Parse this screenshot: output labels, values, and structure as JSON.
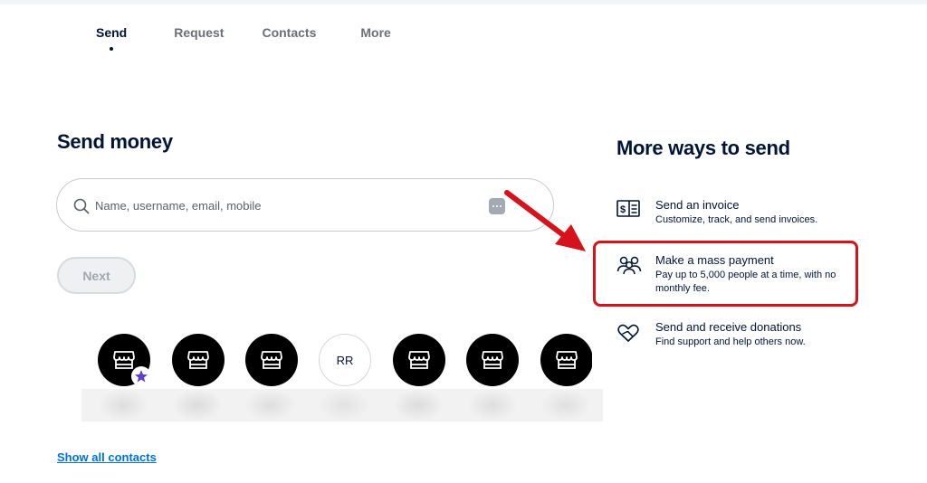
{
  "nav": {
    "tabs": [
      {
        "label": "Send",
        "active": true
      },
      {
        "label": "Request",
        "active": false
      },
      {
        "label": "Contacts",
        "active": false
      },
      {
        "label": "More",
        "active": false
      }
    ]
  },
  "send_money": {
    "title": "Send money",
    "search": {
      "placeholder": "Name, username, email, mobile",
      "value": ""
    },
    "next_label": "Next",
    "contacts": [
      {
        "type": "store-icon",
        "favorite": true
      },
      {
        "type": "store-icon",
        "favorite": false
      },
      {
        "type": "store-icon",
        "favorite": false
      },
      {
        "type": "initials",
        "initials": "RR"
      },
      {
        "type": "store-icon",
        "favorite": false
      },
      {
        "type": "store-icon",
        "favorite": false
      },
      {
        "type": "store-icon",
        "favorite": false
      }
    ],
    "show_all_label": "Show all contacts"
  },
  "more_ways": {
    "title": "More ways to send",
    "items": [
      {
        "icon": "invoice-icon",
        "title": "Send an invoice",
        "desc": "Customize, track, and send invoices."
      },
      {
        "icon": "people-icon",
        "title": "Make a mass payment",
        "desc": "Pay up to 5,000 people at a time, with no monthly fee."
      },
      {
        "icon": "heart-hands-icon",
        "title": "Send and receive donations",
        "desc": "Find support and help others now."
      }
    ]
  },
  "colors": {
    "primary_text": "#001435",
    "link": "#0070e0",
    "annotation_red": "#d6121c",
    "star": "#5b3fd1"
  }
}
